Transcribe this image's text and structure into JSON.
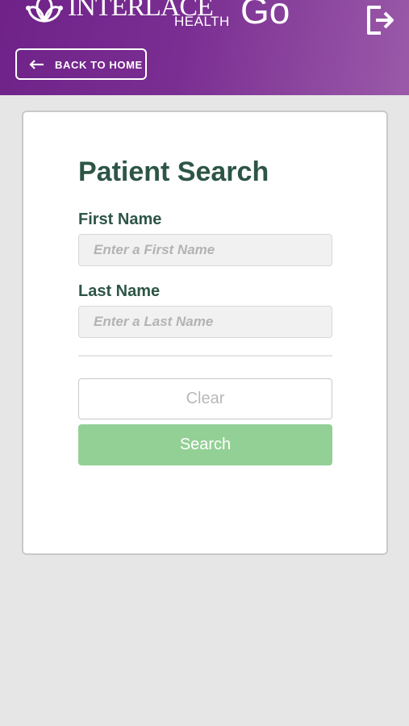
{
  "header": {
    "logo": {
      "wordmark": "INTERLACE",
      "sub": "HEALTH",
      "product": "Go"
    },
    "logout_icon": "logout-icon",
    "back_button": {
      "icon": "arrow-left-icon",
      "label": "BACK TO HOME"
    },
    "colors": {
      "gradient_start": "#6f2288",
      "gradient_end": "#9b5aa9"
    }
  },
  "form": {
    "title": "Patient Search",
    "first_name": {
      "label": "First Name",
      "value": "",
      "placeholder": "Enter a First Name"
    },
    "last_name": {
      "label": "Last Name",
      "value": "",
      "placeholder": "Enter a Last Name"
    },
    "clear_label": "Clear",
    "search_label": "Search",
    "colors": {
      "heading": "#2d5546",
      "search_button": "#93d095"
    }
  }
}
